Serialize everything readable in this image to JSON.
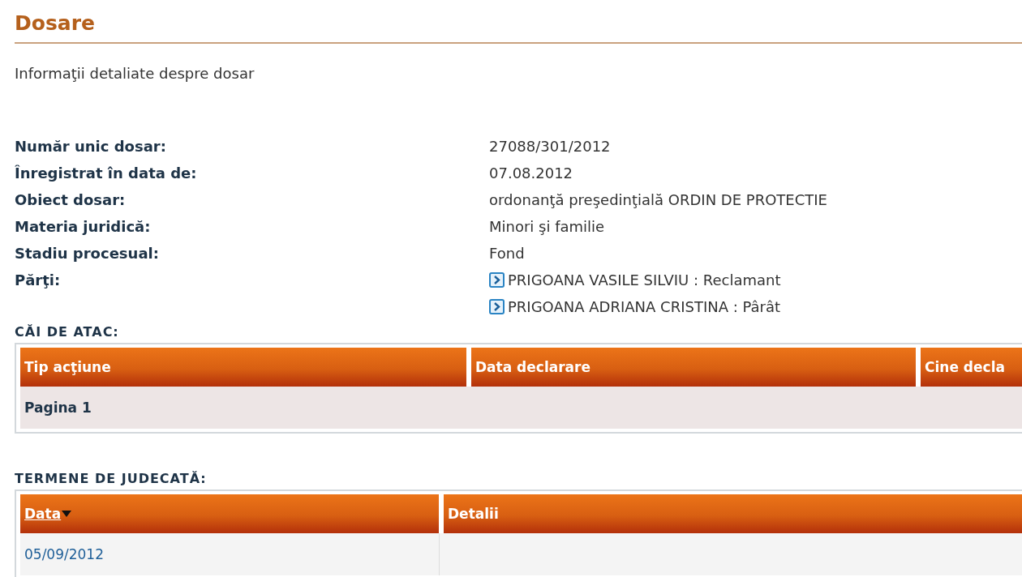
{
  "page": {
    "title": "Dosare",
    "subtitle": "Informaţii detaliate despre dosar"
  },
  "details": [
    {
      "label": "Număr unic dosar:",
      "kind": "text",
      "value": "27088/301/2012"
    },
    {
      "label": "Înregistrat în data de:",
      "kind": "text",
      "value": "07.08.2012"
    },
    {
      "label": "Obiect dosar:",
      "kind": "text",
      "value": "ordonanţă preşedinţială ORDIN DE PROTECTIE"
    },
    {
      "label": "Materia juridică:",
      "kind": "text",
      "value": "Minori şi familie"
    },
    {
      "label": "Stadiu procesual:",
      "kind": "text",
      "value": "Fond"
    },
    {
      "label": "Părţi:",
      "kind": "parties",
      "parties": [
        "PRIGOANA VASILE SILVIU : Reclamant",
        "PRIGOANA ADRIANA CRISTINA : Pârât"
      ]
    }
  ],
  "appeals": {
    "heading": "CĂI DE ATAC:",
    "columns": [
      {
        "label": "Tip acţiune",
        "sorted": false
      },
      {
        "label": "Data declarare",
        "sorted": false
      },
      {
        "label": "Cine decla",
        "sorted": false
      }
    ],
    "rows": [
      {
        "kind": "pager",
        "text": "Pagina 1"
      }
    ]
  },
  "hearings": {
    "heading": "TERMENE DE JUDECATĂ:",
    "columns": [
      {
        "label": "Data",
        "sorted": true
      },
      {
        "label": "Detalii",
        "sorted": false
      }
    ],
    "rows": [
      {
        "kind": "data",
        "date": "05/09/2012"
      }
    ]
  }
}
